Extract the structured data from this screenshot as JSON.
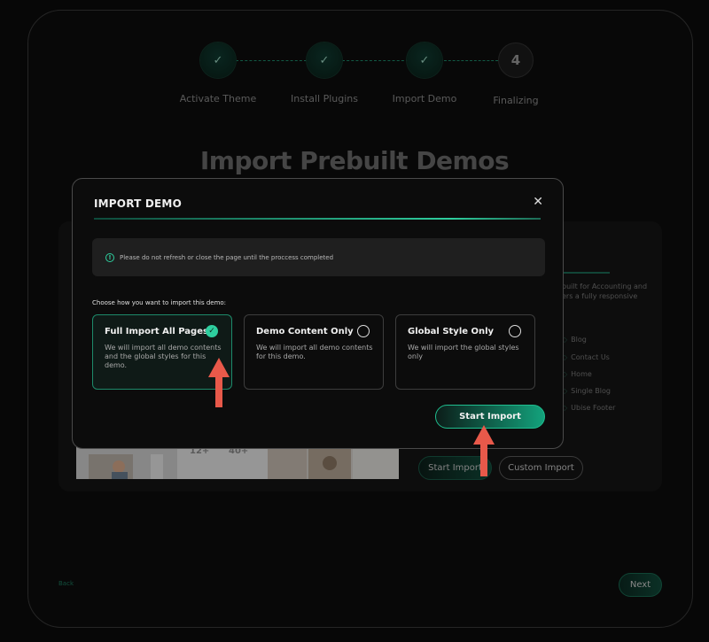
{
  "stepper": {
    "steps": [
      {
        "label": "Activate Theme",
        "status": "done",
        "icon": "check-icon"
      },
      {
        "label": "Install Plugins",
        "status": "done",
        "icon": "check-icon"
      },
      {
        "label": "Import Demo",
        "status": "done",
        "icon": "check-icon"
      },
      {
        "label": "Finalizing",
        "status": "pending",
        "number": "4"
      }
    ]
  },
  "page": {
    "title": "Import Prebuilt Demos",
    "back_label": "Back",
    "next_label": "Next"
  },
  "background_panel": {
    "text_1": "built for Accounting and",
    "text_2": "ers a fully responsive",
    "pages": [
      "Blog",
      "Contact Us",
      "Home",
      "Single Blog",
      "Ubise Footer"
    ],
    "stats": [
      "12+",
      "40+"
    ],
    "start_import_label": "Start Import",
    "custom_import_label": "Custom Import"
  },
  "modal": {
    "title": "IMPORT DEMO",
    "close_icon": "close-icon",
    "notice": "Please do not refresh or close the page until the proccess completed",
    "choose_label": "Choose how you want to import this demo:",
    "options": [
      {
        "title": "Full Import All Pages",
        "desc": "We will import all demo contents and the global styles for this demo.",
        "selected": true
      },
      {
        "title": "Demo Content Only",
        "desc": "We will import all demo contents for this demo.",
        "selected": false
      },
      {
        "title": "Global Style Only",
        "desc": "We will import the global styles only",
        "selected": false
      }
    ],
    "start_label": "Start Import"
  },
  "colors": {
    "accent": "#2ecf9f",
    "arrow": "#e8594a"
  }
}
